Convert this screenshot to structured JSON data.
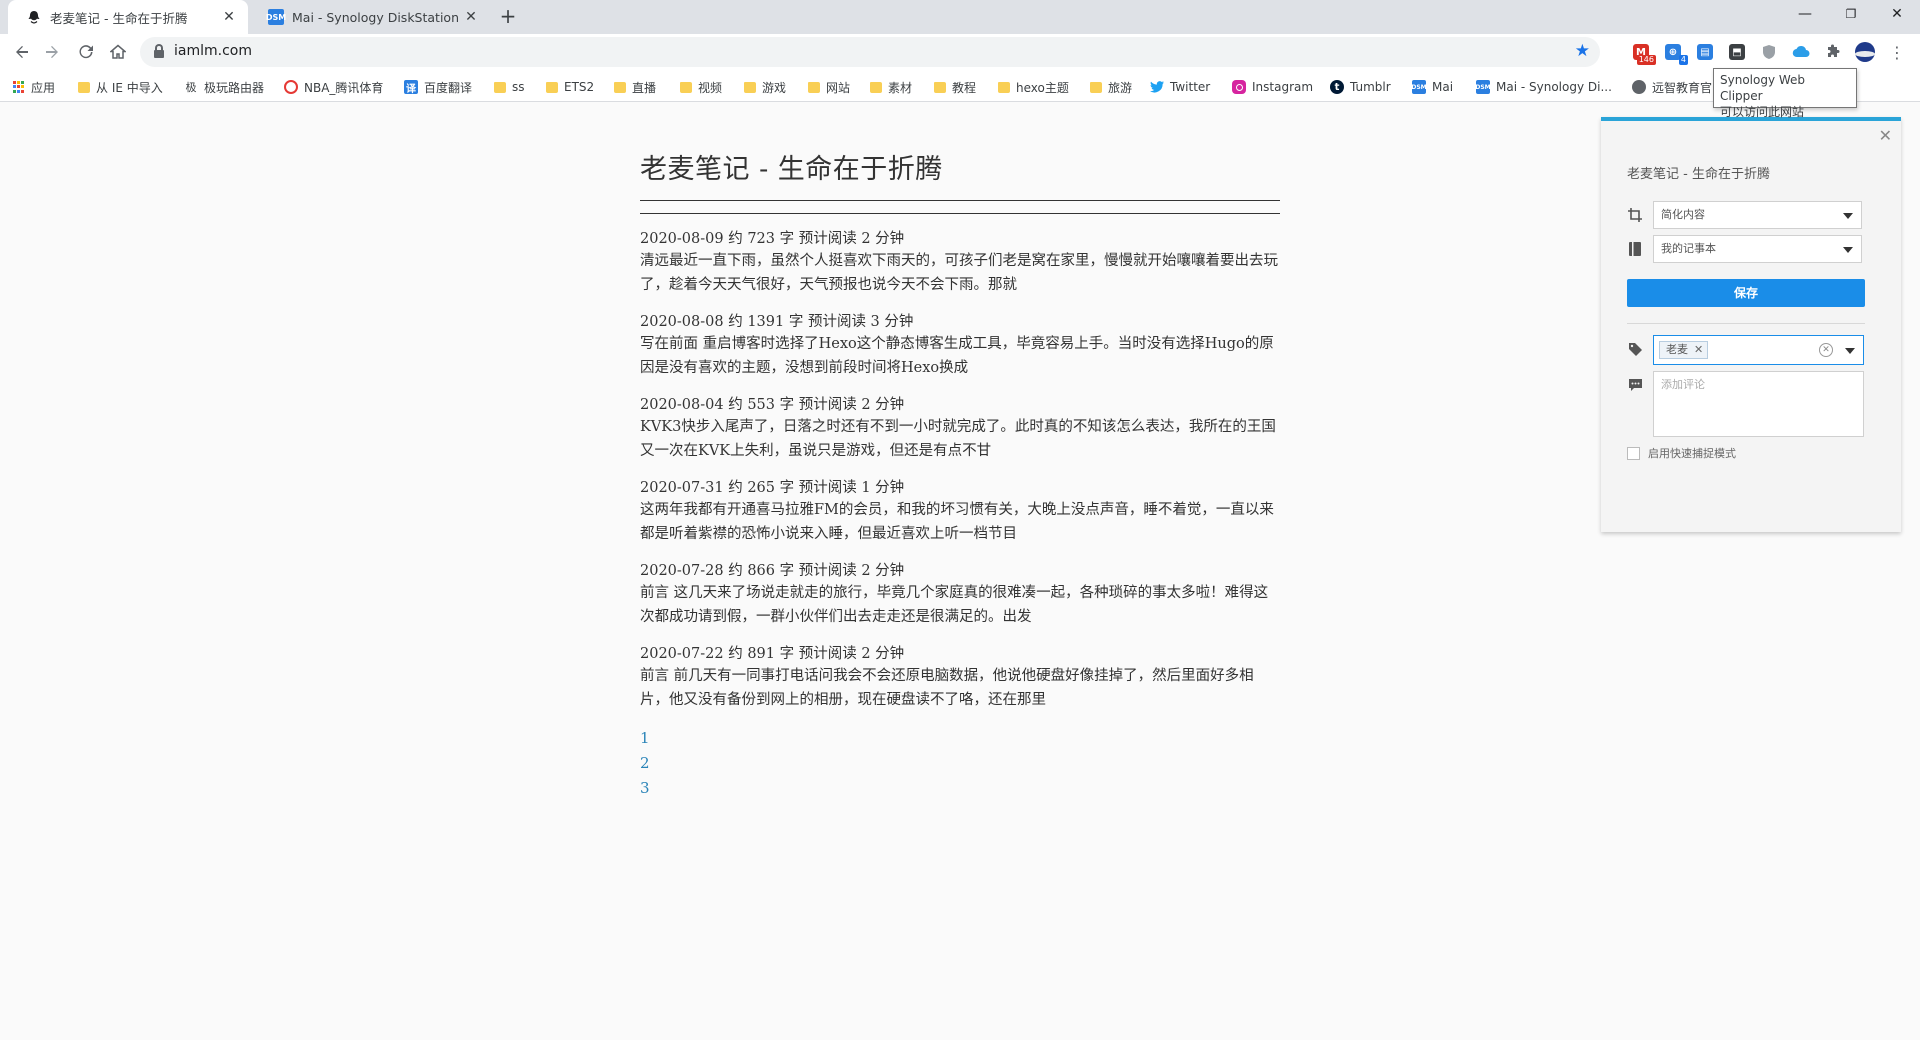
{
  "tabs": [
    {
      "title": "老麦笔记 - 生命在于折腾",
      "close": "✕"
    },
    {
      "title": "Mai - Synology DiskStation",
      "favicon": "DSM",
      "close": "✕"
    }
  ],
  "new_tab": "+",
  "window_controls": {
    "minimize": "—",
    "maximize": "❐",
    "close": "✕"
  },
  "toolbar": {
    "url": "iamlm.com",
    "extensions": [
      {
        "icon": "gmail-icon",
        "badge": "146"
      },
      {
        "icon": "extension-badge-icon",
        "badge": "4"
      },
      {
        "icon": "synology-clipper-icon"
      },
      {
        "icon": "save-icon"
      },
      {
        "icon": "shield-icon"
      },
      {
        "icon": "cloud-icon"
      },
      {
        "icon": "puzzle-icon"
      },
      {
        "icon": "profile-avatar"
      }
    ]
  },
  "bookmarks": [
    {
      "label": "应用",
      "icon": "apps"
    },
    {
      "label": "从 IE 中导入",
      "icon": "folder"
    },
    {
      "label": "极玩路由器",
      "icon": "text",
      "glyph": "极"
    },
    {
      "label": "NBA_腾讯体育",
      "icon": "circle",
      "color": "#e53935"
    },
    {
      "label": "百度翻译",
      "icon": "square",
      "color": "#2b7fe0",
      "glyph": "译"
    },
    {
      "label": "ss",
      "icon": "folder"
    },
    {
      "label": "ETS2",
      "icon": "folder"
    },
    {
      "label": "直播",
      "icon": "folder"
    },
    {
      "label": "视频",
      "icon": "folder"
    },
    {
      "label": "游戏",
      "icon": "folder"
    },
    {
      "label": "网站",
      "icon": "folder"
    },
    {
      "label": "素材",
      "icon": "folder"
    },
    {
      "label": "教程",
      "icon": "folder"
    },
    {
      "label": "hexo主题",
      "icon": "folder"
    },
    {
      "label": "旅游",
      "icon": "folder"
    },
    {
      "label": "Twitter",
      "icon": "twitter"
    },
    {
      "label": "Instagram",
      "icon": "instagram"
    },
    {
      "label": "Tumblr",
      "icon": "tumblr"
    },
    {
      "label": "Mai",
      "icon": "dsm"
    },
    {
      "label": "Mai - Synology Di...",
      "icon": "dsm"
    },
    {
      "label": "远智教育官",
      "icon": "globe"
    }
  ],
  "tooltip": {
    "line1": "Synology Web Clipper",
    "line2": "可以访问此网站"
  },
  "page": {
    "site_title": "老麦笔记 - 生命在于折腾",
    "posts": [
      {
        "meta": "2020-08-09 约 723 字 预计阅读 2 分钟",
        "excerpt": "清远最近一直下雨，虽然个人挺喜欢下雨天的，可孩子们老是窝在家里，慢慢就开始嚷嚷着要出去玩了，趁着今天天气很好，天气预报也说今天不会下雨。那就"
      },
      {
        "meta": "2020-08-08 约 1391 字 预计阅读 3 分钟",
        "excerpt": "写在前面 重启博客时选择了Hexo这个静态博客生成工具，毕竟容易上手。当时没有选择Hugo的原因是没有喜欢的主题，没想到前段时间将Hexo换成"
      },
      {
        "meta": "2020-08-04 约 553 字 预计阅读 2 分钟",
        "excerpt": "KVK3快步入尾声了，日落之时还有不到一小时就完成了。此时真的不知该怎么表达，我所在的王国又一次在KVK上失利，虽说只是游戏，但还是有点不甘"
      },
      {
        "meta": "2020-07-31 约 265 字 预计阅读 1 分钟",
        "excerpt": "这两年我都有开通喜马拉雅FM的会员，和我的坏习惯有关，大晚上没点声音，睡不着觉，一直以来都是听着紫襟的恐怖小说来入睡，但最近喜欢上听一档节目"
      },
      {
        "meta": "2020-07-28 约 866 字 预计阅读 2 分钟",
        "excerpt": "前言 这几天来了场说走就走的旅行，毕竟几个家庭真的很难凑一起，各种琐碎的事太多啦！难得这次都成功请到假，一群小伙伴们出去走走还是很满足的。出发"
      },
      {
        "meta": "2020-07-22 约 891 字 预计阅读 2 分钟",
        "excerpt": "前言 前几天有一同事打电话问我会不会还原电脑数据，他说他硬盘好像挂掉了，然后里面好多相片，他又没有备份到网上的相册，现在硬盘读不了咯，还在那里"
      }
    ],
    "pagination": [
      "1",
      "2",
      "3"
    ]
  },
  "clipper": {
    "close": "✕",
    "page_title": "老麦笔记 - 生命在于折腾",
    "clip_mode": "简化内容",
    "notebook": "我的记事本",
    "save_label": "保存",
    "tag": "老麦",
    "tag_remove": "✕",
    "comment_placeholder": "添加评论",
    "quick_mode_label": "启用快速捕捉模式",
    "accent": "#1a8de8"
  }
}
